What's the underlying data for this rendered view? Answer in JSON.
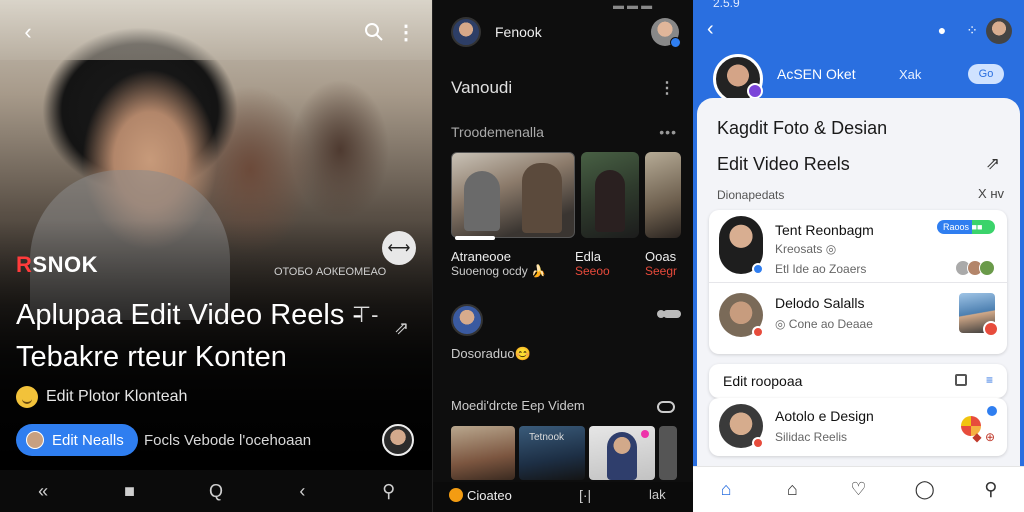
{
  "panel1": {
    "brand_prefix": "R",
    "brand_rest": "SNOK",
    "caption": "ОТОБО АОКЕОМЕАО",
    "title": "Aplupaa Edit Video Reels - Tebakre rteur Konten",
    "title_tail": "⊤-",
    "subtitle": "Edit Plotor Klonteah",
    "cta_label": "Edit Nealls",
    "cta_side": "Focls Vebode l'ocehoaan",
    "icons": {
      "back": "‹",
      "more": "⋮",
      "swap": "⟷",
      "share": "⇗"
    },
    "nav": [
      "«",
      "■",
      "Q",
      "‹",
      "⚲"
    ]
  },
  "panel2": {
    "status": "▬  ▬ ▬",
    "profile_name": "Fenook",
    "section_title": "Vanoudi",
    "section_more": "⋮",
    "recents_label": "Troodemenalla",
    "recents_more": "•••",
    "thumbs": [
      {
        "name": "Atraneooe",
        "sub": "Suoenog ocdy 🍌"
      },
      {
        "name": "Edla",
        "sub": "Seeoo"
      },
      {
        "name": "Ooas",
        "sub": "Seegr"
      }
    ],
    "row_label": "Dosoraduo😊",
    "strip_label": "Moedi'drcte Eep Videm",
    "strip_text": "Tetnook",
    "nav_label": "Cioateo",
    "nav_b": "[·|",
    "nav_c": "lak"
  },
  "panel3": {
    "status": "2.5.9",
    "user_name": "AcSEN Oket",
    "user_tag": "Xak",
    "pill": "Go",
    "title1": "Kagdit Foto & Desian",
    "title2": "Edit Video Reels",
    "share": "⇗",
    "meta": "Dionapedats",
    "meta_x": "X ʜv",
    "card_rows": [
      {
        "name": "Tent Reonbagm",
        "sub1": "Kreosats ◎",
        "sub2": "Etl Ide ao Zoaers",
        "pill": "Raoos ■■"
      },
      {
        "name": "Delodo Salalls",
        "sub": "◎ Cone ao Deaae"
      }
    ],
    "section_label": "Edit roopoaa",
    "section_icon": "≡",
    "feature": {
      "name": "Aotolo e Design",
      "sub": "Silidac Reelis",
      "note": "◆ ⊕"
    },
    "nav": [
      "⌂",
      "⌂",
      "♡",
      "◯",
      "⚲"
    ]
  }
}
